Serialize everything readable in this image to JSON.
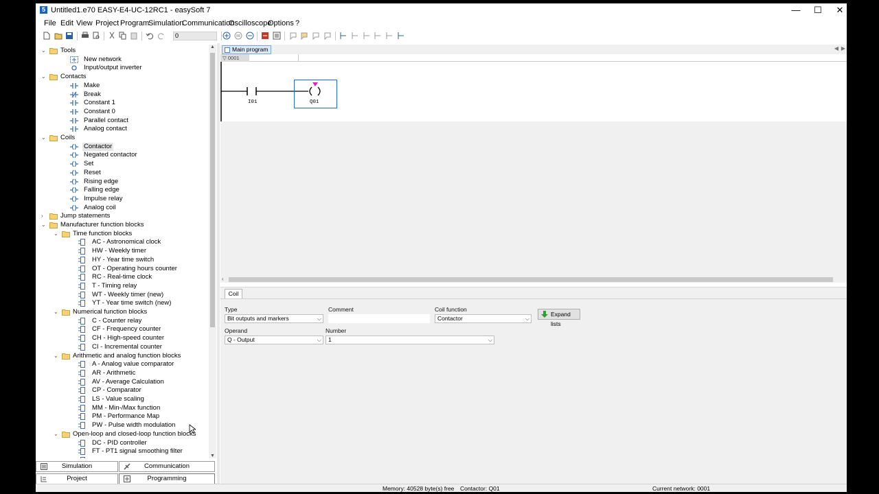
{
  "window": {
    "title": "Untitled1.e70 EASY-E4-UC-12RC1 - easySoft 7",
    "controls": {
      "minimize": "—",
      "maximize": "☐",
      "close": "✕"
    }
  },
  "menu": [
    "File",
    "Edit",
    "View",
    "Project",
    "Program",
    "Simulation",
    "Communication",
    "Oscilloscope",
    "Options",
    "?"
  ],
  "toolbar": {
    "zoom_value": "0"
  },
  "tree": {
    "rows": [
      {
        "level": 0,
        "expander": "open",
        "icon": "folder",
        "label": "Tools"
      },
      {
        "level": 1,
        "icon": "network",
        "label": "New network"
      },
      {
        "level": 1,
        "icon": "inverter",
        "label": "Input/output inverter"
      },
      {
        "level": 0,
        "expander": "open",
        "icon": "folder",
        "label": "Contacts"
      },
      {
        "level": 1,
        "icon": "contact",
        "label": "Make"
      },
      {
        "level": 1,
        "icon": "contact-nc",
        "label": "Break"
      },
      {
        "level": 1,
        "icon": "contact",
        "label": "Constant 1"
      },
      {
        "level": 1,
        "icon": "contact",
        "label": "Constant 0"
      },
      {
        "level": 1,
        "icon": "contact",
        "label": "Parallel contact"
      },
      {
        "level": 1,
        "icon": "contact",
        "label": "Analog contact"
      },
      {
        "level": 0,
        "expander": "open",
        "icon": "folder",
        "label": "Coils"
      },
      {
        "level": 1,
        "icon": "coil",
        "label": "Contactor",
        "selected": true
      },
      {
        "level": 1,
        "icon": "coil",
        "label": "Negated contactor"
      },
      {
        "level": 1,
        "icon": "coil",
        "label": "Set"
      },
      {
        "level": 1,
        "icon": "coil",
        "label": "Reset"
      },
      {
        "level": 1,
        "icon": "coil",
        "label": "Rising edge"
      },
      {
        "level": 1,
        "icon": "coil",
        "label": "Falling edge"
      },
      {
        "level": 1,
        "icon": "coil",
        "label": "Impulse relay"
      },
      {
        "level": 1,
        "icon": "coil",
        "label": "Analog coil"
      },
      {
        "level": 0,
        "expander": "closed",
        "icon": "folder",
        "label": "Jump statements"
      },
      {
        "level": 0,
        "expander": "open",
        "icon": "folder",
        "label": "Manufacturer function blocks"
      },
      {
        "level": 1,
        "expander": "open",
        "icon": "folder",
        "label": "Time function blocks"
      },
      {
        "level": 2,
        "icon": "block",
        "label": "AC - Astronomical clock"
      },
      {
        "level": 2,
        "icon": "block",
        "label": "HW - Weekly timer"
      },
      {
        "level": 2,
        "icon": "block",
        "label": "HY - Year time switch"
      },
      {
        "level": 2,
        "icon": "block",
        "label": "OT - Operating hours counter"
      },
      {
        "level": 2,
        "icon": "block",
        "label": "RC - Real-time clock"
      },
      {
        "level": 2,
        "icon": "block",
        "label": "T - Timing relay"
      },
      {
        "level": 2,
        "icon": "block",
        "label": "WT - Weekly timer (new)"
      },
      {
        "level": 2,
        "icon": "block",
        "label": "YT - Year time switch (new)"
      },
      {
        "level": 1,
        "expander": "open",
        "icon": "folder",
        "label": "Numerical function blocks"
      },
      {
        "level": 2,
        "icon": "block",
        "label": "C - Counter relay"
      },
      {
        "level": 2,
        "icon": "block",
        "label": "CF - Frequency counter"
      },
      {
        "level": 2,
        "icon": "block",
        "label": "CH - High-speed counter"
      },
      {
        "level": 2,
        "icon": "block",
        "label": "CI - Incremental counter"
      },
      {
        "level": 1,
        "expander": "open",
        "icon": "folder",
        "label": "Arithmetic and analog function blocks"
      },
      {
        "level": 2,
        "icon": "block",
        "label": "A - Analog value comparator"
      },
      {
        "level": 2,
        "icon": "block",
        "label": "AR - Arithmetic"
      },
      {
        "level": 2,
        "icon": "block",
        "label": "AV - Average Calculation"
      },
      {
        "level": 2,
        "icon": "block",
        "label": "CP - Comparator"
      },
      {
        "level": 2,
        "icon": "block",
        "label": "LS - Value scaling"
      },
      {
        "level": 2,
        "icon": "block",
        "label": "MM - Min-/Max function"
      },
      {
        "level": 2,
        "icon": "block",
        "label": "PM - Performance Map"
      },
      {
        "level": 2,
        "icon": "block",
        "label": "PW - Pulse width modulation"
      },
      {
        "level": 1,
        "expander": "open",
        "icon": "folder",
        "label": "Open-loop and closed-loop function blocks"
      },
      {
        "level": 2,
        "icon": "block",
        "label": "DC - PID controller"
      },
      {
        "level": 2,
        "icon": "block",
        "label": "FT - PT1 signal smoothing filter"
      },
      {
        "level": 2,
        "icon": "block",
        "label": ""
      }
    ]
  },
  "bottom_tabs": {
    "simulation": "Simulation",
    "communication": "Communication",
    "project": "Project",
    "programming": "Programming"
  },
  "editor": {
    "tab_label": "Main program",
    "network_number": "0001",
    "contact_operand": "I01",
    "coil_operand": "Q01"
  },
  "properties": {
    "tab_label": "Coil",
    "type_label": "Type",
    "type_value": "Bit outputs and markers",
    "comment_label": "Comment",
    "comment_value": "",
    "coil_function_label": "Coil function",
    "coil_function_value": "Contactor",
    "expand_button": "Expand lists",
    "operand_label": "Operand",
    "operand_value": "Q - Output",
    "number_label": "Number",
    "number_value": "1"
  },
  "status": {
    "memory": "Memory: 40528 byte(s) free",
    "selection": "Contactor: Q01",
    "network": "Current network: 0001"
  }
}
